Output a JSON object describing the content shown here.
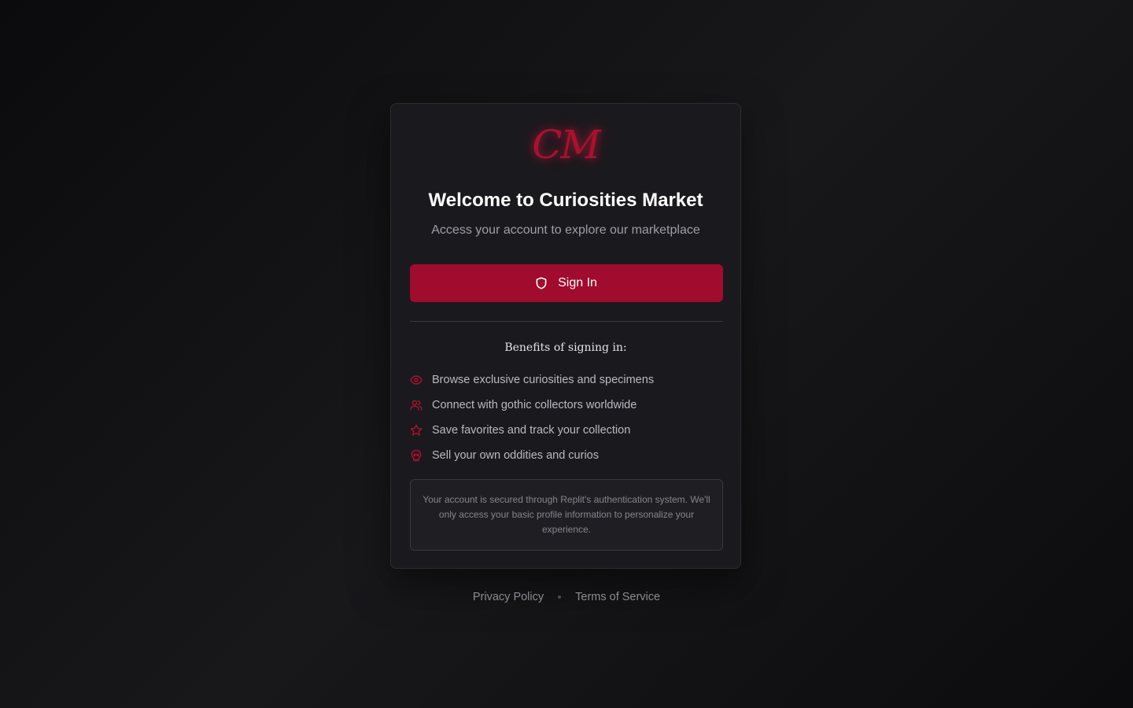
{
  "brand": {
    "logo_text": "CM",
    "accent_color": "#a10b2d"
  },
  "card": {
    "title": "Welcome to Curiosities Market",
    "subtitle": "Access your account to explore our marketplace",
    "signin_label": "Sign In",
    "signin_icon": "shield-icon",
    "benefits_heading": "Benefits of signing in:",
    "benefits": [
      {
        "icon": "eye-icon",
        "label": "Browse exclusive curiosities and specimens"
      },
      {
        "icon": "users-icon",
        "label": "Connect with gothic collectors worldwide"
      },
      {
        "icon": "star-icon",
        "label": "Save favorites and track your collection"
      },
      {
        "icon": "skull-icon",
        "label": "Sell your own oddities and curios"
      }
    ],
    "notice": "Your account is secured through Replit's authentication system. We'll only access your basic profile information to personalize your experience."
  },
  "footer": {
    "privacy_label": "Privacy Policy",
    "terms_label": "Terms of Service"
  }
}
